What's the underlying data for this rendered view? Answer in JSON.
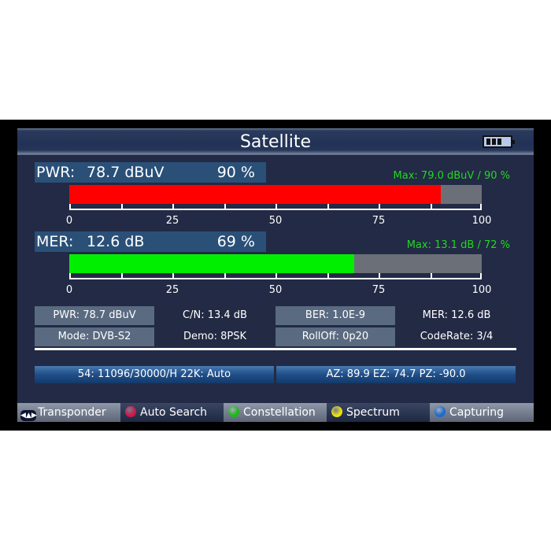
{
  "header": {
    "title": "Satellite",
    "battery_icon": "battery-icon",
    "battery_level_bars": 3
  },
  "meters": [
    {
      "name": "PWR:",
      "value": "78.7 dBuV",
      "percent_label": "90 %",
      "percent": 90,
      "max_label": "Max: 79.0 dBuV / 90 %",
      "bar_color": "#ff0000"
    },
    {
      "name": "MER:",
      "value": "12.6 dB",
      "percent_label": "69 %",
      "percent": 69,
      "max_label": "Max: 13.1 dB  / 72 %",
      "bar_color": "#00ee00"
    }
  ],
  "scale": {
    "labels": [
      "0",
      "25",
      "50",
      "75",
      "100"
    ]
  },
  "info_grid": [
    [
      "PWR: 78.7 dBuV",
      "C/N: 13.4 dB",
      "BER: 1.0E-9",
      "MER: 12.6 dB"
    ],
    [
      "Mode: DVB-S2",
      "Demo: 8PSK",
      "RollOff: 0p20",
      "CodeRate: 3/4"
    ]
  ],
  "transponder_info": "54: 11096/30000/H 22K: Auto",
  "position_info": "AZ: 89.9  EZ: 74.7  PZ: -90.0",
  "footer": [
    {
      "label": "Transponder",
      "icon": "dpad-icon",
      "color": ""
    },
    {
      "label": "Auto Search",
      "icon": "red-button-icon",
      "color": "#d0184a"
    },
    {
      "label": "Constellation",
      "icon": "green-button-icon",
      "color": "#1cb81c"
    },
    {
      "label": "Spectrum",
      "icon": "yellow-button-icon",
      "color": "#e8e010"
    },
    {
      "label": "Capturing",
      "icon": "blue-button-icon",
      "color": "#1a6ad0"
    }
  ]
}
